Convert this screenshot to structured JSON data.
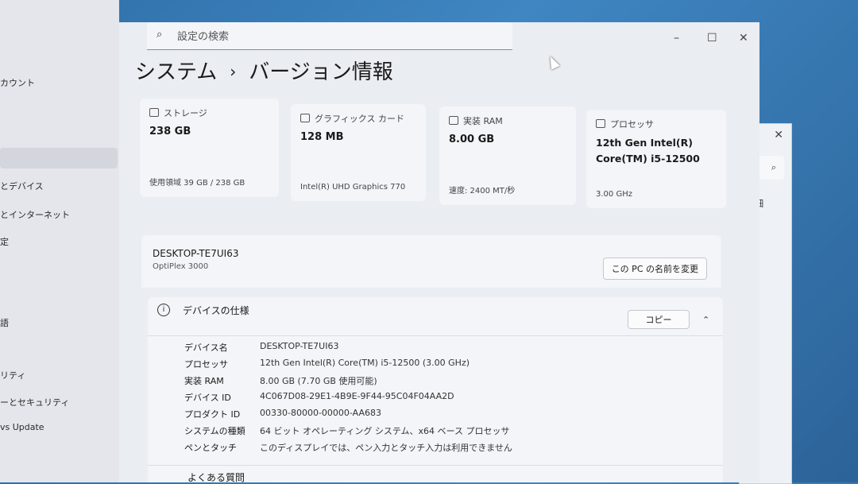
{
  "nav": {
    "items": [
      "カウント",
      "とデバイス",
      "とインターネット",
      "定",
      "語",
      "リティ",
      "ーとセキュリティ",
      "vs Update"
    ]
  },
  "search": {
    "placeholder": "設定の検索"
  },
  "window": {
    "minimize": "–",
    "maximize": "☐",
    "close": "✕"
  },
  "header": {
    "section": "システム",
    "separator": "›",
    "page": "バージョン情報"
  },
  "cards": [
    {
      "label": "ストレージ",
      "value": "238 GB",
      "sub": "使用領域 39 GB / 238 GB"
    },
    {
      "label": "グラフィックス カード",
      "value": "128 MB",
      "sub": "Intel(R) UHD Graphics 770"
    },
    {
      "label": "実装 RAM",
      "value": "8.00 GB",
      "sub": "速度: 2400 MT/秒"
    },
    {
      "label": "プロセッサ",
      "value": "12th Gen Intel(R) Core(TM) i5-12500",
      "sub": "3.00 GHz"
    }
  ],
  "device": {
    "name": "DESKTOP-TE7UI63",
    "model": "OptiPlex 3000",
    "rename_label": "この PC の名前を変更"
  },
  "specs": {
    "title": "デバイスの仕様",
    "copy_label": "コピー",
    "rows": [
      {
        "key": "デバイス名",
        "value": "DESKTOP-TE7UI63"
      },
      {
        "key": "プロセッサ",
        "value": "12th Gen Intel(R) Core(TM) i5-12500 (3.00 GHz)"
      },
      {
        "key": "実装 RAM",
        "value": "8.00 GB (7.70 GB 使用可能)"
      },
      {
        "key": "デバイス ID",
        "value": "4C067D08-29E1-4B9E-9F44-95C04F04AA2D"
      },
      {
        "key": "プロダクト ID",
        "value": "00330-80000-00000-AA683"
      },
      {
        "key": "システムの種類",
        "value": "64 ビット オペレーティング システム、x64 ベース プロセッサ"
      },
      {
        "key": "ペンとタッチ",
        "value": "このディスプレイでは、ペン入力とタッチ入力は利用できません"
      }
    ]
  },
  "faq": {
    "title": "よくある質問"
  },
  "bg_window": {
    "close": "✕",
    "detail": "詳細"
  }
}
